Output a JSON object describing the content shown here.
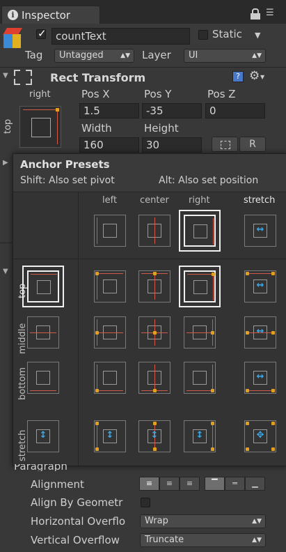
{
  "tab": {
    "title": "Inspector"
  },
  "object": {
    "name": "countText",
    "static_label": "Static",
    "tag_label": "Tag",
    "tag_value": "Untagged",
    "layer_label": "Layer",
    "layer_value": "UI"
  },
  "rect_transform": {
    "title": "Rect Transform",
    "anchor_h": "right",
    "anchor_v": "top",
    "pos_x_label": "Pos X",
    "pos_y_label": "Pos Y",
    "pos_z_label": "Pos Z",
    "pos_x": "1.5",
    "pos_y": "-35",
    "pos_z": "0",
    "width_label": "Width",
    "height_label": "Height",
    "width": "160",
    "height": "30",
    "reset_label": "R"
  },
  "anchor_presets": {
    "title": "Anchor Presets",
    "hint_shift": "Shift: Also set pivot",
    "hint_alt": "Alt: Also set position",
    "columns": [
      "left",
      "center",
      "right",
      "stretch"
    ],
    "rows": [
      "top",
      "middle",
      "bottom",
      "stretch"
    ]
  },
  "paragraph": {
    "title": "Paragraph",
    "alignment_label": "Alignment",
    "align_by_geometry_label": "Align By Geometr",
    "horizontal_overflow_label": "Horizontal Overflo",
    "horizontal_overflow_value": "Wrap",
    "vertical_overflow_label": "Vertical Overflow",
    "vertical_overflow_value": "Truncate"
  }
}
